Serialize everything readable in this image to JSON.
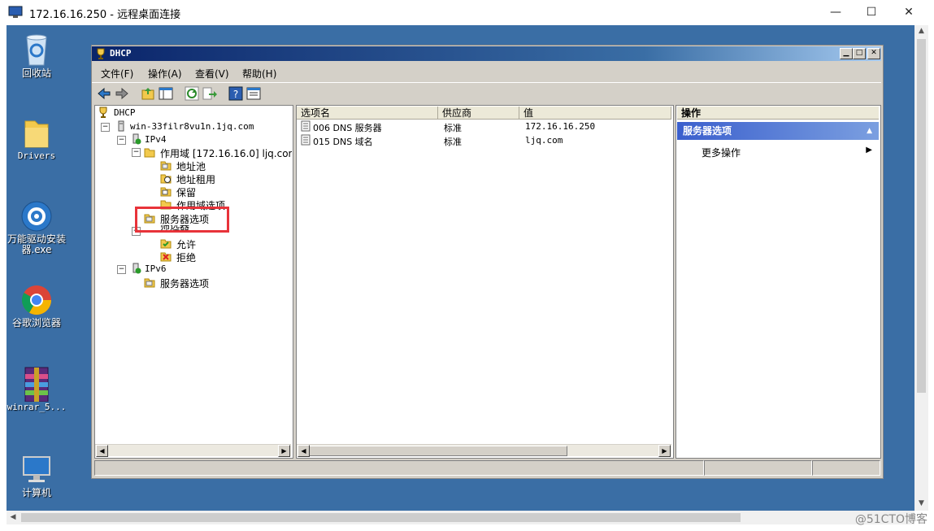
{
  "rdp": {
    "title": "172.16.16.250 - 远程桌面连接",
    "minimize": "—",
    "maximize": "☐",
    "close": "✕"
  },
  "watermark": "@51CTO博客",
  "desktop_icons": [
    {
      "label": "回收站",
      "icon": "recycle-bin-icon"
    },
    {
      "label": "Drivers",
      "icon": "folder-icon"
    },
    {
      "label": "万能驱动安装器.exe",
      "icon": "gear-icon"
    },
    {
      "label": "谷歌浏览器",
      "icon": "chrome-icon"
    },
    {
      "label": "winrar_5...",
      "icon": "winrar-icon"
    },
    {
      "label": "计算机",
      "icon": "computer-icon"
    }
  ],
  "dhcp": {
    "title": "DHCP",
    "menus": [
      "文件(F)",
      "操作(A)",
      "查看(V)",
      "帮助(H)"
    ],
    "tree": {
      "root": "DHCP",
      "server": "win-33filr8vu1n.1jq.com",
      "ipv4": "IPv4",
      "scope": "作用域 [172.16.16.0] ljq.com",
      "address_pool": "地址池",
      "address_leases": "地址租用",
      "reservations": "保留",
      "scope_options": "作用域选项",
      "server_options": "服务器选项",
      "filters": "筛选器",
      "allow": "允许",
      "deny": "拒绝",
      "ipv6": "IPv6",
      "ipv6_server_options": "服务器选项"
    },
    "list": {
      "columns": [
        "选项名",
        "供应商",
        "值"
      ],
      "rows": [
        {
          "name": "006 DNS 服务器",
          "vendor": "标准",
          "value": "172.16.16.250"
        },
        {
          "name": "015 DNS 域名",
          "vendor": "标准",
          "value": "ljq.com"
        }
      ]
    },
    "actions": {
      "header": "操作",
      "section": "服务器选项",
      "more": "更多操作"
    }
  }
}
